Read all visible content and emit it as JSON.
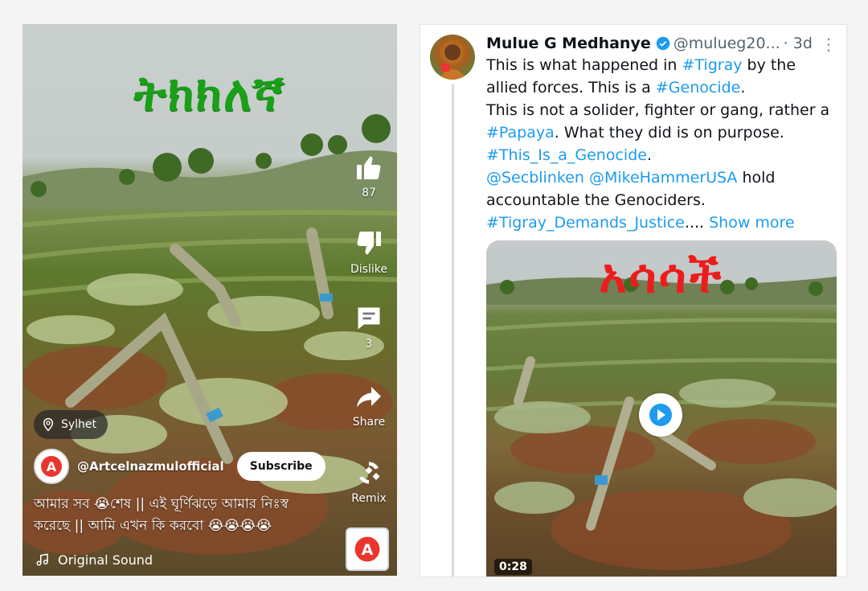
{
  "left_panel": {
    "overlay_title": "ትክክለኛ",
    "overlay_color": "#19a018",
    "actions": [
      {
        "icon": "thumbs-up-icon",
        "label": "87"
      },
      {
        "icon": "thumbs-down-icon",
        "label": "Dislike"
      },
      {
        "icon": "comment-icon",
        "label": "3"
      },
      {
        "icon": "share-icon",
        "label": "Share"
      },
      {
        "icon": "remix-icon",
        "label": "Remix"
      }
    ],
    "location": "Sylhet",
    "channel": "@Artcelnazmulofficial",
    "subscribe_label": "Subscribe",
    "caption_line1": "আমার সব 😭শেষ || এই ঘূর্ণিঝড়ে আমার নিঃস্ব",
    "caption_line2": "করেছে || আমি এখন কি করবো 😭😭😭😭",
    "sound_label": "Original Sound"
  },
  "right_panel": {
    "author_name": "Mulue G Medhanye",
    "handle": "@mulueg20...",
    "time": "· 3d",
    "body": {
      "l1_pre": "This is what happened in ",
      "l1_tag": "#Tigray",
      "l1_post": " by the",
      "l2_pre": "allied forces. This is a ",
      "l2_tag": "#Genocide",
      "l2_post": ".",
      "l3": "This is not a solider, fighter or gang, rather a",
      "l4_tag": "#Papaya",
      "l4_post": ". What they did is on purpose.",
      "l5_tag": "#This_Is_a_Genocide",
      "l5_post": ".",
      "l6_m1": "@Secblinken",
      "l6_m2": "@MikeHammerUSA",
      "l6_post": "  hold",
      "l7": "accountable the Genociders.",
      "l8_tag": "#Tigray_Demands_Justice",
      "l8_post": "....",
      "show_more": " Show more"
    },
    "media_title": "አሳሳች",
    "media_title_color": "#ed1c1c",
    "duration": "0:28",
    "link_color": "#1d9bf0"
  }
}
